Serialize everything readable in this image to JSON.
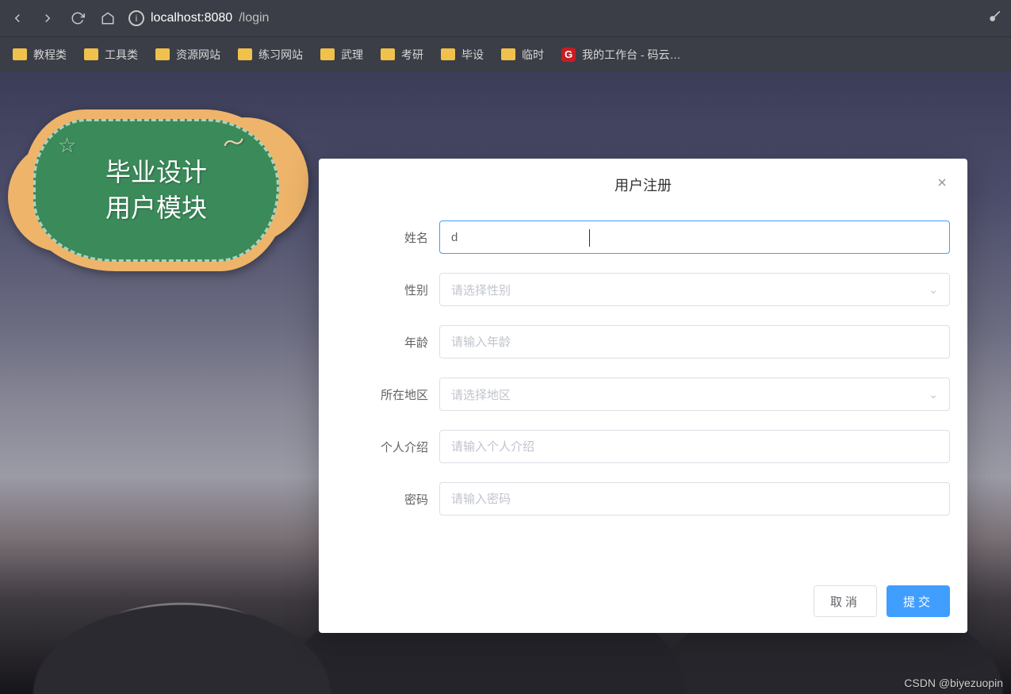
{
  "browser": {
    "url_host": "localhost:8080",
    "url_path": "/login"
  },
  "bookmarks": [
    {
      "type": "folder",
      "label": "教程类"
    },
    {
      "type": "folder",
      "label": "工具类"
    },
    {
      "type": "folder",
      "label": "资源网站"
    },
    {
      "type": "folder",
      "label": "练习网站"
    },
    {
      "type": "folder",
      "label": "武理"
    },
    {
      "type": "folder",
      "label": "考研"
    },
    {
      "type": "folder",
      "label": "毕设"
    },
    {
      "type": "folder",
      "label": "临时"
    },
    {
      "type": "gitee",
      "label": "我的工作台 - 码云…"
    }
  ],
  "badge": {
    "line1": "毕业设计",
    "line2": "用户模块"
  },
  "modal": {
    "title": "用户注册",
    "fields": {
      "name": {
        "label": "姓名",
        "value": "d",
        "placeholder": ""
      },
      "gender": {
        "label": "性别",
        "placeholder": "请选择性别"
      },
      "age": {
        "label": "年龄",
        "placeholder": "请输入年龄"
      },
      "region": {
        "label": "所在地区",
        "placeholder": "请选择地区"
      },
      "bio": {
        "label": "个人介绍",
        "placeholder": "请输入个人介绍"
      },
      "password": {
        "label": "密码",
        "placeholder": "请输入密码"
      }
    },
    "buttons": {
      "cancel": "取消",
      "submit": "提交"
    }
  },
  "watermark": "CSDN @biyezuopin"
}
